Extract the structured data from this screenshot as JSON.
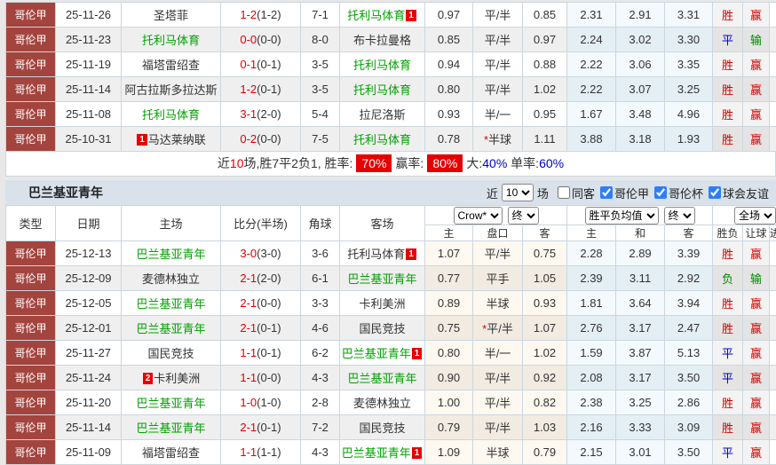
{
  "colors": {
    "league_bg": "#a4443e",
    "accent_red": "#e10000",
    "accent_blue": "#0000cc",
    "team_green": "#00a000",
    "lose_green": "#008800",
    "rate_badge_bg": "#e60000",
    "section_bar_bg": "#d9e1ea",
    "checkbox_blue": "#2f7df6"
  },
  "top_table": {
    "rows": [
      {
        "league": "哥伦甲",
        "date": "25-11-26",
        "home": "圣塔菲",
        "home_class": "",
        "score_ft": "1-2",
        "score_ht": "(1-2)",
        "corner": "7-1",
        "away": "托利马体育",
        "away_class": "self",
        "away_badge_post": "1",
        "ah": "0.97",
        "hcap": "平/半",
        "aa": "0.85",
        "eu_h": "2.31",
        "eu_d": "2.91",
        "eu_a": "3.31",
        "res": "胜",
        "res_class": "win",
        "yld": "赢",
        "yld_class": "win"
      },
      {
        "league": "哥伦甲",
        "date": "25-11-23",
        "home": "托利马体育",
        "home_class": "self",
        "score_ft": "0-0",
        "score_ht": "(0-0)",
        "corner": "8-0",
        "away": "布卡拉曼格",
        "away_class": "",
        "ah": "0.85",
        "hcap": "平/半",
        "aa": "0.97",
        "eu_h": "2.24",
        "eu_d": "3.02",
        "eu_a": "3.30",
        "res": "平",
        "res_class": "draw",
        "yld": "输",
        "yld_class": "lose"
      },
      {
        "league": "哥伦甲",
        "date": "25-11-19",
        "home": "福塔雷绍查",
        "home_class": "",
        "score_ft": "0-1",
        "score_ht": "(0-1)",
        "corner": "3-5",
        "away": "托利马体育",
        "away_class": "self",
        "ah": "0.94",
        "hcap": "平/半",
        "aa": "0.88",
        "eu_h": "2.22",
        "eu_d": "3.06",
        "eu_a": "3.35",
        "res": "胜",
        "res_class": "win",
        "yld": "赢",
        "yld_class": "win"
      },
      {
        "league": "哥伦甲",
        "date": "25-11-14",
        "home": "阿古拉斯多拉达斯",
        "home_class": "",
        "score_ft": "1-2",
        "score_ht": "(0-1)",
        "corner": "3-5",
        "away": "托利马体育",
        "away_class": "self",
        "ah": "0.80",
        "hcap": "平/半",
        "aa": "1.02",
        "eu_h": "2.22",
        "eu_d": "3.07",
        "eu_a": "3.25",
        "res": "胜",
        "res_class": "win",
        "yld": "赢",
        "yld_class": "win"
      },
      {
        "league": "哥伦甲",
        "date": "25-11-08",
        "home": "托利马体育",
        "home_class": "self",
        "score_ft": "3-1",
        "score_ht": "(2-0)",
        "corner": "5-4",
        "away": "拉尼洛斯",
        "away_class": "",
        "ah": "0.93",
        "hcap": "半/一",
        "aa": "0.95",
        "eu_h": "1.67",
        "eu_d": "3.48",
        "eu_a": "4.96",
        "res": "胜",
        "res_class": "win",
        "yld": "赢",
        "yld_class": "win"
      },
      {
        "league": "哥伦甲",
        "date": "25-10-31",
        "home": "马达莱纳联",
        "home_class": "",
        "home_badge_pre": "1",
        "score_ft": "0-2",
        "score_ht": "(0-0)",
        "corner": "7-5",
        "away": "托利马体育",
        "away_class": "self",
        "ah": "0.78",
        "hcap_star": "*",
        "hcap": "半球",
        "aa": "1.11",
        "eu_h": "3.88",
        "eu_d": "3.18",
        "eu_a": "1.93",
        "res": "胜",
        "res_class": "win",
        "yld": "赢",
        "yld_class": "win"
      }
    ]
  },
  "summary": {
    "near": "近",
    "count": "10",
    "mid": "场,胜7平2负1, 胜率:",
    "win_rate": "70%",
    "yield_label": "赢率:",
    "yield_rate": "80%",
    "big_label": "大:",
    "big_rate": "40%",
    "single_label": "单率:",
    "single_rate": "60%"
  },
  "section": {
    "title": "巴兰基亚青年",
    "near_label": "近",
    "near_value": "10",
    "matches_label": "场",
    "filters": [
      {
        "label": "同客",
        "checked": false
      },
      {
        "label": "哥伦甲",
        "checked": true
      },
      {
        "label": "哥伦杯",
        "checked": true
      },
      {
        "label": "球会友谊",
        "checked": true
      }
    ]
  },
  "bottom_table": {
    "headers": {
      "type": "类型",
      "date": "日期",
      "home": "主场",
      "score": "比分(半场)",
      "corner": "角球",
      "away": "客场",
      "crown_select": "Crow*",
      "final_select_1": "终",
      "avg_select": "胜平负均值",
      "final_select_2": "终",
      "scope_select": "全场",
      "sub_home": "主",
      "sub_hcap": "盘口",
      "sub_away": "客",
      "sub_avg_home": "主",
      "sub_avg_draw": "和",
      "sub_avg_away": "客",
      "sub_wdl": "胜负",
      "sub_handicap": "让球",
      "sub_cut": "进球"
    },
    "rows": [
      {
        "league": "哥伦甲",
        "date": "25-12-13",
        "home": "巴兰基亚青年",
        "home_class": "self",
        "score_ft": "3-0",
        "score_ht": "(3-0)",
        "corner": "3-6",
        "away": "托利马体育",
        "away_class": "",
        "away_badge_post": "1",
        "ah": "1.07",
        "hcap": "平/半",
        "aa": "0.75",
        "eu_h": "2.28",
        "eu_d": "2.89",
        "eu_a": "3.39",
        "res": "胜",
        "res_class": "win",
        "yld": "赢",
        "yld_class": "win"
      },
      {
        "league": "哥伦甲",
        "date": "25-12-09",
        "home": "麦德林独立",
        "home_class": "",
        "score_ft": "2-1",
        "score_ht": "(2-0)",
        "corner": "6-1",
        "away": "巴兰基亚青年",
        "away_class": "self",
        "ah": "0.77",
        "hcap": "平手",
        "aa": "1.05",
        "eu_h": "2.39",
        "eu_d": "3.11",
        "eu_a": "2.92",
        "res": "负",
        "res_class": "lose",
        "yld": "输",
        "yld_class": "lose"
      },
      {
        "league": "哥伦甲",
        "date": "25-12-05",
        "home": "巴兰基亚青年",
        "home_class": "self",
        "score_ft": "2-1",
        "score_ht": "(0-0)",
        "corner": "3-3",
        "away": "卡利美洲",
        "away_class": "",
        "ah": "0.89",
        "hcap": "半球",
        "aa": "0.93",
        "eu_h": "1.81",
        "eu_d": "3.64",
        "eu_a": "3.94",
        "res": "胜",
        "res_class": "win",
        "yld": "赢",
        "yld_class": "win"
      },
      {
        "league": "哥伦甲",
        "date": "25-12-01",
        "home": "巴兰基亚青年",
        "home_class": "self",
        "score_ft": "2-1",
        "score_ht": "(0-1)",
        "corner": "4-6",
        "away": "国民竞技",
        "away_class": "",
        "ah": "0.75",
        "hcap_star": "*",
        "hcap": "平/半",
        "aa": "1.07",
        "eu_h": "2.76",
        "eu_d": "3.17",
        "eu_a": "2.47",
        "res": "胜",
        "res_class": "win",
        "yld": "赢",
        "yld_class": "win"
      },
      {
        "league": "哥伦甲",
        "date": "25-11-27",
        "home": "国民竞技",
        "home_class": "",
        "score_ft": "1-1",
        "score_ht": "(0-1)",
        "corner": "6-2",
        "away": "巴兰基亚青年",
        "away_class": "self",
        "away_badge_post": "1",
        "ah": "0.80",
        "hcap": "半/一",
        "aa": "1.02",
        "eu_h": "1.59",
        "eu_d": "3.87",
        "eu_a": "5.13",
        "res": "平",
        "res_class": "draw",
        "yld": "赢",
        "yld_class": "win"
      },
      {
        "league": "哥伦甲",
        "date": "25-11-24",
        "home": "卡利美洲",
        "home_class": "",
        "home_badge_pre": "2",
        "score_ft": "1-1",
        "score_ht": "(0-0)",
        "corner": "4-3",
        "away": "巴兰基亚青年",
        "away_class": "self",
        "ah": "0.90",
        "hcap": "平/半",
        "aa": "0.92",
        "eu_h": "2.08",
        "eu_d": "3.17",
        "eu_a": "3.50",
        "res": "平",
        "res_class": "draw",
        "yld": "赢",
        "yld_class": "win"
      },
      {
        "league": "哥伦甲",
        "date": "25-11-20",
        "home": "巴兰基亚青年",
        "home_class": "self",
        "score_ft": "1-0",
        "score_ht": "(1-0)",
        "corner": "2-8",
        "away": "麦德林独立",
        "away_class": "",
        "ah": "1.00",
        "hcap": "平/半",
        "aa": "0.82",
        "eu_h": "2.38",
        "eu_d": "3.25",
        "eu_a": "2.86",
        "res": "胜",
        "res_class": "win",
        "yld": "赢",
        "yld_class": "win"
      },
      {
        "league": "哥伦甲",
        "date": "25-11-14",
        "home": "巴兰基亚青年",
        "home_class": "self",
        "score_ft": "2-1",
        "score_ht": "(0-1)",
        "corner": "7-2",
        "away": "国民竞技",
        "away_class": "",
        "ah": "0.79",
        "hcap": "平/半",
        "aa": "1.03",
        "eu_h": "2.16",
        "eu_d": "3.33",
        "eu_a": "3.09",
        "res": "胜",
        "res_class": "win",
        "yld": "赢",
        "yld_class": "win"
      },
      {
        "league": "哥伦甲",
        "date": "25-11-09",
        "home": "福塔雷绍查",
        "home_class": "",
        "score_ft": "1-1",
        "score_ht": "(1-1)",
        "corner": "4-3",
        "away": "巴兰基亚青年",
        "away_class": "self",
        "away_badge_post": "1",
        "ah": "1.09",
        "hcap": "半球",
        "aa": "0.79",
        "eu_h": "2.15",
        "eu_d": "3.01",
        "eu_a": "3.50",
        "res": "平",
        "res_class": "draw",
        "yld": "赢",
        "yld_class": "win"
      }
    ]
  }
}
